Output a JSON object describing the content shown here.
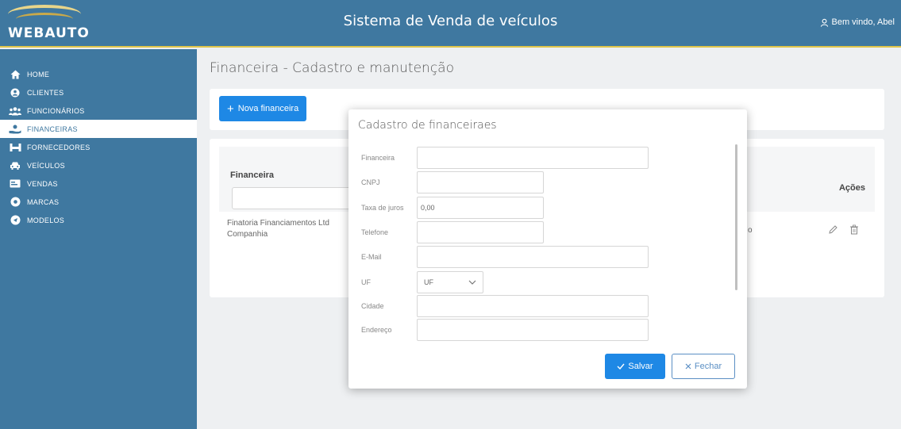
{
  "header": {
    "logo_text": "WEBAUTO",
    "title": "Sistema de Venda de veículos",
    "welcome": "Bem vindo, Abel",
    "user_icon": "user-icon"
  },
  "sidebar": {
    "items": [
      {
        "label": "HOME",
        "icon": "home-icon"
      },
      {
        "label": "CLIENTES",
        "icon": "person-icon"
      },
      {
        "label": "FUNCIONÁRIOS",
        "icon": "group-icon"
      },
      {
        "label": "FINANCEIRAS",
        "icon": "money-hand-icon"
      },
      {
        "label": "FORNECEDORES",
        "icon": "truck-icon"
      },
      {
        "label": "VEÍCULOS",
        "icon": "car-icon"
      },
      {
        "label": "VENDAS",
        "icon": "card-icon"
      },
      {
        "label": "MARCAS",
        "icon": "tag-icon"
      },
      {
        "label": "MODELOS",
        "icon": "model-icon"
      }
    ]
  },
  "main": {
    "page_title": "Financeira - Cadastro e manutenção",
    "new_button": "Nova financeira",
    "table": {
      "column_financeira": "Financeira",
      "column_acoes": "Ações",
      "rows": [
        {
          "name": "Finatoria Financiamentos Ltd Companhia",
          "tail": "o"
        }
      ]
    }
  },
  "dialog": {
    "title": "Cadastro de financeiraes",
    "fields": {
      "financeira": {
        "label": "Financeira",
        "value": ""
      },
      "cnpj": {
        "label": "CNPJ",
        "value": ""
      },
      "taxa": {
        "label": "Taxa de juros",
        "value": "0,00"
      },
      "telefone": {
        "label": "Telefone",
        "value": ""
      },
      "email": {
        "label": "E-Mail",
        "value": ""
      },
      "uf": {
        "label": "UF",
        "value": "UF"
      },
      "cidade": {
        "label": "Cidade",
        "value": ""
      },
      "endereco": {
        "label": "Endereço",
        "value": ""
      }
    },
    "save_label": "Salvar",
    "close_label": "Fechar"
  },
  "colors": {
    "primary": "#3f78a0",
    "accent": "#1e88e5",
    "gold": "#e0c54a"
  }
}
